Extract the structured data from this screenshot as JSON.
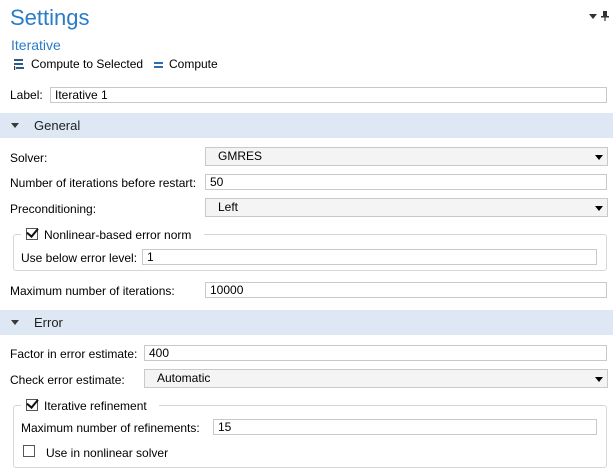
{
  "header": {
    "title": "Settings",
    "subtitle": "Iterative"
  },
  "toolbar": {
    "compute_selected_label": "Compute to Selected",
    "compute_label": "Compute"
  },
  "label_field": {
    "label": "Label:",
    "value": "Iterative 1"
  },
  "sections": {
    "general": "General",
    "error": "Error"
  },
  "general": {
    "solver_label": "Solver:",
    "solver_value": "GMRES",
    "restart_label": "Number of iterations before restart:",
    "restart_value": "50",
    "precond_label": "Preconditioning:",
    "precond_value": "Left",
    "nonlinear_norm_label": "Nonlinear-based error norm",
    "nonlinear_norm_checked": true,
    "error_level_label": "Use below error level:",
    "error_level_value": "1",
    "max_iter_label": "Maximum number of iterations:",
    "max_iter_value": "10000"
  },
  "error": {
    "factor_label": "Factor in error estimate:",
    "factor_value": "400",
    "check_label": "Check error estimate:",
    "check_value": "Automatic",
    "refinement_label": "Iterative refinement",
    "refinement_checked": true,
    "max_ref_label": "Maximum number of refinements:",
    "max_ref_value": "15",
    "use_nonlinear_label": "Use in nonlinear solver",
    "use_nonlinear_checked": false
  },
  "colors": {
    "accent": "#2a7cc7",
    "section_bg": "#dde8f4"
  }
}
